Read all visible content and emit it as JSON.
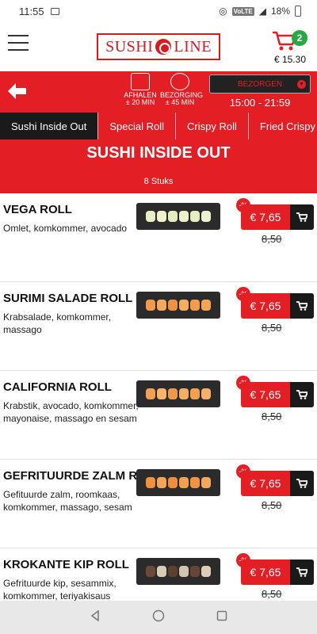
{
  "status": {
    "time": "11:55",
    "volte": "VoLTE",
    "battery": "18%"
  },
  "header": {
    "logo_left": "SUSHI",
    "logo_right": "LINE",
    "cart_count": "2",
    "cart_total": "€ 15.30"
  },
  "order_bar": {
    "afhalen_label": "AFHALEN",
    "afhalen_time": "± 20 MIN",
    "bezorging_label": "BEZORGING",
    "bezorging_time": "± 45 MIN",
    "mode_select": "BEZORGEN",
    "hours": "15:00 - 21:59"
  },
  "tabs": [
    {
      "label": "Sushi Inside Out"
    },
    {
      "label": "Special Roll"
    },
    {
      "label": "Crispy Roll"
    },
    {
      "label": "Fried Crispy"
    }
  ],
  "section": {
    "title": "SUSHI INSIDE OUT",
    "count": "8 Stuks"
  },
  "discount_symbol": "-%",
  "products": [
    {
      "name": "VEGA ROLL",
      "description": "Omlet, komkommer, avocado",
      "price": "€ 7,65",
      "old_price": "8,50"
    },
    {
      "name": "SURIMI SALADE ROLL",
      "description": "Krabsalade, komkommer, massago",
      "price": "€ 7,65",
      "old_price": "8,50"
    },
    {
      "name": "CALIFORNIA ROLL",
      "description": "Krabstik, avocado, komkommer, mayonaise, massago en sesam",
      "price": "€ 7,65",
      "old_price": "8,50"
    },
    {
      "name": "GEFRITUURDE ZALM ROLL",
      "description": "Gefituurde zalm, roomkaas, komkommer, massago, sesam",
      "price": "€ 7,65",
      "old_price": "8,50"
    },
    {
      "name": "KROKANTE KIP ROLL",
      "description": "Gefrituurde kip, sesammix, komkommer, teriyakisaus",
      "price": "€ 7,65",
      "old_price": "8,50"
    }
  ],
  "colors": {
    "brand_red": "#e31e24",
    "dark": "#1a1a1a",
    "badge_green": "#27a844"
  }
}
